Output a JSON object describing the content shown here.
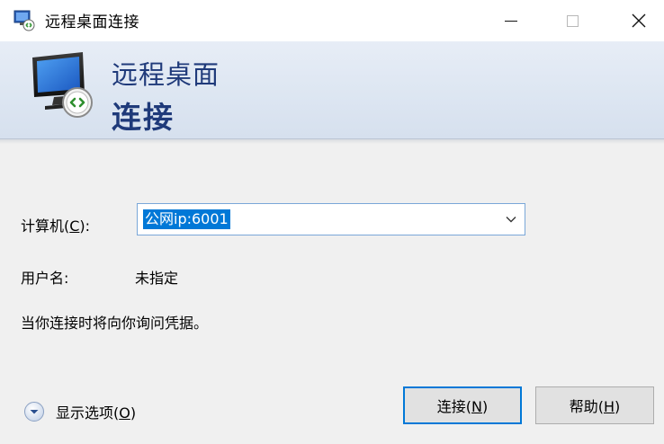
{
  "window": {
    "title": "远程桌面连接",
    "icon": "remote-desktop-icon",
    "controls": {
      "minimize": "minimize-icon",
      "maximize": "maximize-icon",
      "close": "close-icon"
    }
  },
  "banner": {
    "title_line1": "远程桌面",
    "title_line2": "连接",
    "icon": "monitor-connection-icon"
  },
  "form": {
    "computer_label_prefix": "计算机(",
    "computer_label_key": "C",
    "computer_label_suffix": "):",
    "computer_value": "公网ip:6001",
    "username_label": "用户名:",
    "username_value": "未指定",
    "info": "当你连接时将向你询问凭据。"
  },
  "options": {
    "label_prefix": "显示选项(",
    "label_key": "O",
    "label_suffix": ")",
    "icon": "chevron-down-circle-icon"
  },
  "buttons": {
    "connect": {
      "prefix": "连接(",
      "key": "N",
      "suffix": ")"
    },
    "help": {
      "prefix": "帮助(",
      "key": "H",
      "suffix": ")"
    }
  },
  "colors": {
    "accent": "#0078d7",
    "banner_text": "#1f3a7a",
    "background": "#f0f0f0"
  }
}
